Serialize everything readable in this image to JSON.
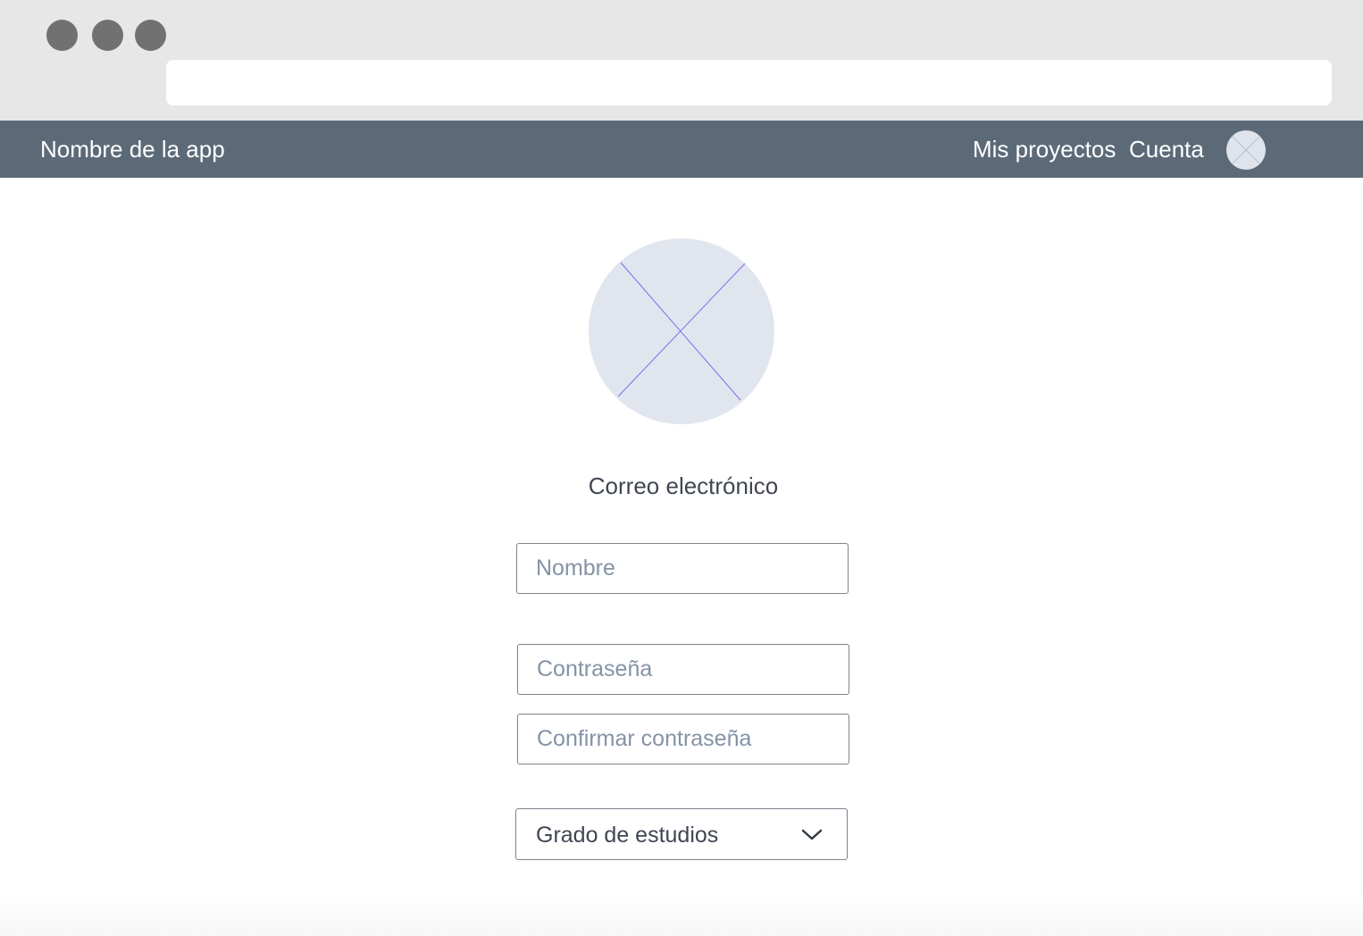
{
  "nav": {
    "app_name": "Nombre de la app",
    "links": [
      "Mis proyectos",
      "Cuenta"
    ],
    "avatar_icon": "avatar-placeholder-icon"
  },
  "profile": {
    "avatar_icon": "image-placeholder-icon",
    "email_label": "Correo electrónico"
  },
  "form": {
    "name_placeholder": "Nombre",
    "password_placeholder": "Contraseña",
    "confirm_placeholder": "Confirmar contraseña",
    "education_select": "Grado de estudios",
    "chevron_icon": "chevron-down-icon"
  },
  "colors": {
    "nav_bg": "#5c6a78",
    "placeholder": "#8593a6",
    "avatar_bg": "#e1e6ee",
    "placeholder_cross": "#7b6ef0"
  }
}
